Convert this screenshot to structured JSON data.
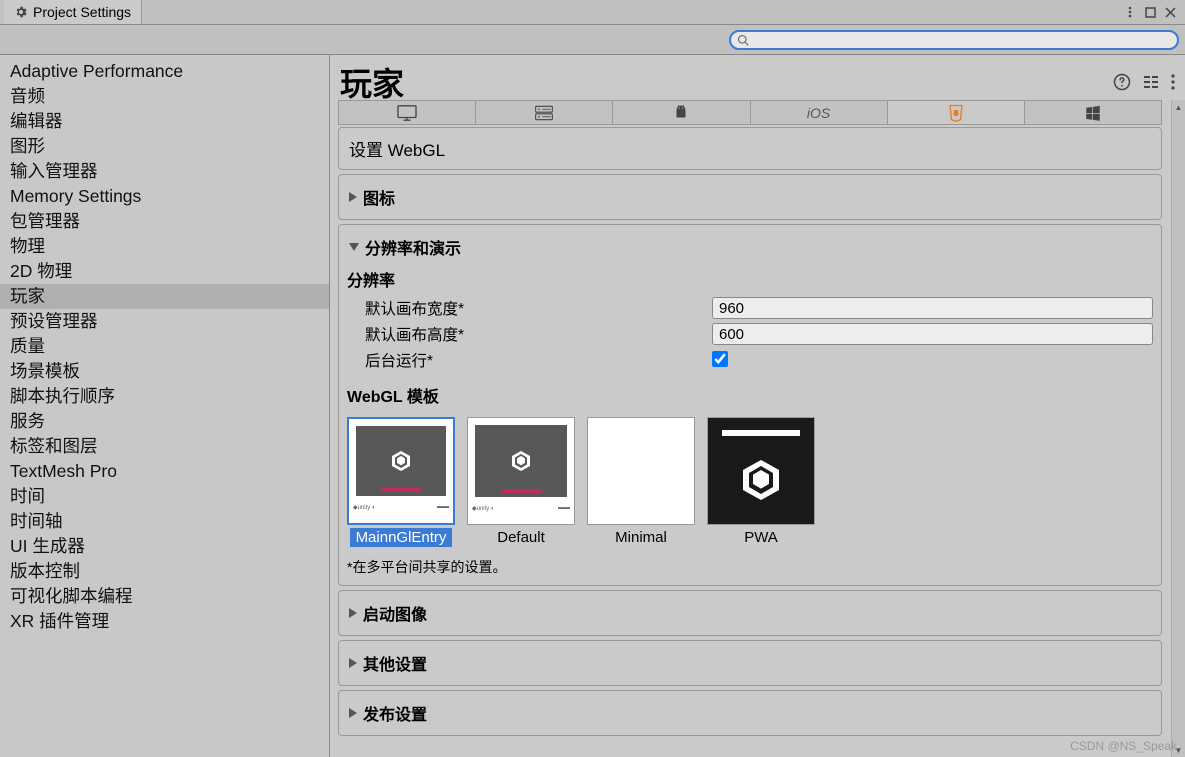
{
  "window": {
    "title": "Project Settings"
  },
  "search": {
    "placeholder": ""
  },
  "sidebar": {
    "items": [
      {
        "label": "Adaptive Performance"
      },
      {
        "label": "音频"
      },
      {
        "label": "编辑器"
      },
      {
        "label": "图形"
      },
      {
        "label": "输入管理器"
      },
      {
        "label": "Memory Settings"
      },
      {
        "label": "包管理器"
      },
      {
        "label": "物理"
      },
      {
        "label": "2D 物理"
      },
      {
        "label": "玩家",
        "selected": true
      },
      {
        "label": "预设管理器"
      },
      {
        "label": "质量"
      },
      {
        "label": "场景模板"
      },
      {
        "label": "脚本执行顺序"
      },
      {
        "label": "服务"
      },
      {
        "label": "标签和图层"
      },
      {
        "label": "TextMesh Pro"
      },
      {
        "label": "时间"
      },
      {
        "label": "时间轴"
      },
      {
        "label": "UI 生成器"
      },
      {
        "label": "版本控制"
      },
      {
        "label": "可视化脚本编程"
      },
      {
        "label": "XR 插件管理"
      }
    ]
  },
  "page": {
    "title": "玩家",
    "platform_section_title": "设置 WebGL",
    "platforms": [
      "desktop",
      "server",
      "android",
      "ios",
      "webgl",
      "windows"
    ],
    "active_platform": 4,
    "sections": {
      "icon": {
        "label": "图标",
        "expanded": false
      },
      "resolution": {
        "label": "分辨率和演示",
        "expanded": true,
        "sub_header": "分辨率",
        "canvas_width_label": "默认画布宽度*",
        "canvas_width_value": "960",
        "canvas_height_label": "默认画布高度*",
        "canvas_height_value": "600",
        "run_bg_label": "后台运行*",
        "run_bg_value": true,
        "templates_header": "WebGL 模板",
        "templates": [
          {
            "name": "MainnGlEntry",
            "selected": true
          },
          {
            "name": "Default"
          },
          {
            "name": "Minimal"
          },
          {
            "name": "PWA"
          }
        ],
        "footnote": "*在多平台间共享的设置。"
      },
      "splash": {
        "label": "启动图像",
        "expanded": false
      },
      "other": {
        "label": "其他设置",
        "expanded": false
      },
      "publish": {
        "label": "发布设置",
        "expanded": false
      }
    }
  },
  "watermark": "CSDN @NS_Speak"
}
